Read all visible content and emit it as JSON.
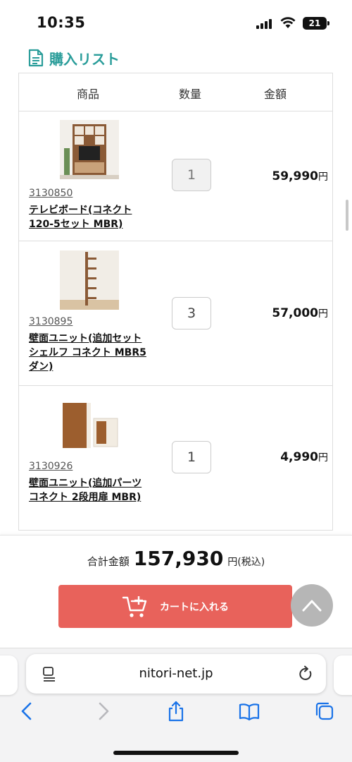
{
  "status_bar": {
    "time": "10:35",
    "battery": "21"
  },
  "list": {
    "title": "購入リスト",
    "headers": {
      "product": "商品",
      "quantity": "数量",
      "amount": "金額"
    },
    "items": [
      {
        "code": "3130850",
        "name": "テレビボード(コネクト120-5セット MBR)",
        "quantity": "1",
        "price": "59,990",
        "currency": "円"
      },
      {
        "code": "3130895",
        "name": "壁面ユニット(追加セット シェルフ コネクト MBR5ダン)",
        "quantity": "3",
        "price": "57,000",
        "currency": "円"
      },
      {
        "code": "3130926",
        "name": "壁面ユニット(追加パーツ コネクト 2段用扉 MBR)",
        "quantity": "1",
        "price": "4,990",
        "currency": "円"
      }
    ]
  },
  "summary": {
    "total_label": "合計金額",
    "total_amount": "157,930",
    "total_suffix": "円(税込)",
    "cart_button": "カートに入れる"
  },
  "browser": {
    "url": "nitori-net.jp"
  },
  "colors": {
    "accent": "#2a9d9a",
    "cart_button": "#e8625b",
    "ios_blue": "#1a73e8"
  }
}
